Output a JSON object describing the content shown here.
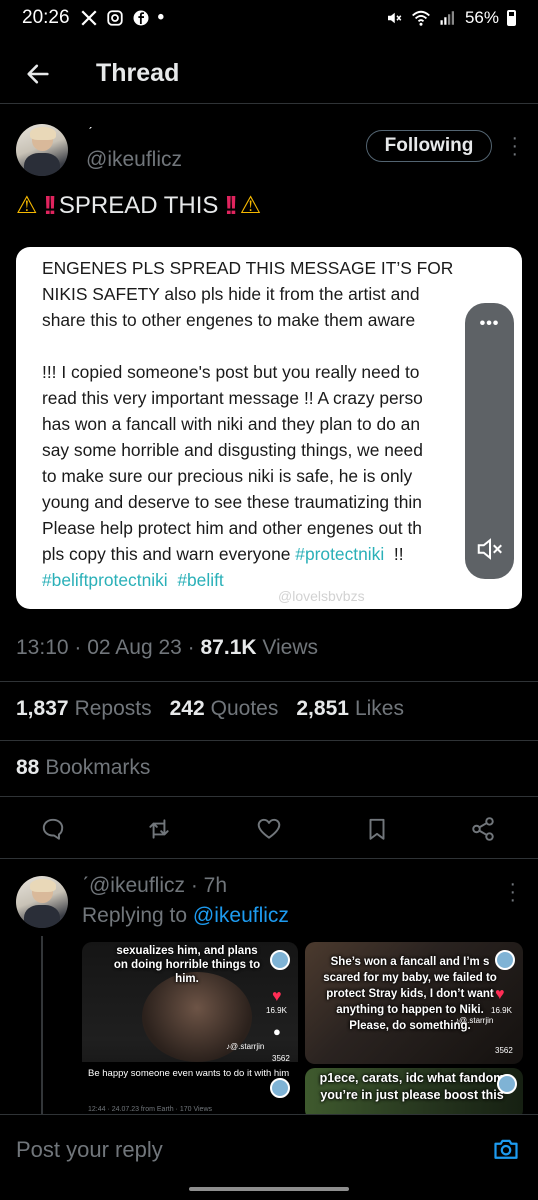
{
  "status_bar": {
    "time": "20:26",
    "left_icons": [
      "x-icon",
      "instagram-icon",
      "facebook-icon"
    ],
    "dot": "•",
    "battery": "56%"
  },
  "header": {
    "title": "Thread"
  },
  "post": {
    "tick": "ˊ",
    "handle": "@ikeuflicz",
    "follow_label": "Following",
    "text": "SPREAD THIS",
    "media": {
      "lines": [
        "ENGENES PLS SPREAD THIS MESSAGE IT’S FOR",
        "NIKIS SAFETY also pls hide it from the artist and",
        "share this to other engenes to make them aware",
        "",
        "!!! I copied someone's post but you really need to",
        "read this very important message !! A crazy perso",
        "has won a fancall with niki and they plan to do an",
        "say some horrible and disgusting things, we need",
        "to make sure our precious niki is safe, he is only",
        "young and deserve to see these traumatizing thin",
        "Please help protect him and other engenes out th",
        "pls copy this and warn everyone"
      ],
      "hashtag_inline": "#protectniki",
      "trail": "!!",
      "hashtags_last": [
        "#beliftprotectniki",
        "#belift"
      ],
      "watermark": "@lovelsbvbzs",
      "overlay_dots": "•••"
    },
    "time": "13:10",
    "date": "02 Aug 23",
    "views_num": "87.1K",
    "views_label": "Views",
    "stats": {
      "reposts": "1,837",
      "reposts_label": "Reposts",
      "quotes": "242",
      "quotes_label": "Quotes",
      "likes": "2,851",
      "likes_label": "Likes"
    },
    "bookmarks": "88",
    "bookmarks_label": "Bookmarks"
  },
  "reply": {
    "handle": "ˊ@ikeuflicz · 7h",
    "replying_to": "Replying to",
    "replying_handle": "@ikeuflicz",
    "thumb1": {
      "caption": "sexualizes him, and plans on doing horrible things to him.",
      "likes": "16.9K",
      "user": "♪@.starrjin",
      "count": "3562",
      "bottom_caption": "Be happy someone even wants to do it with him",
      "footer": "12:44 · 24.07.23 from Earth · 170 Views"
    },
    "thumb2": {
      "caption": "She’s won a fancall and I’m s scared for my baby, we failed to protect Stray kids, I don’t want anything to happen to Niki. Please, do something.",
      "likes": "16.9K",
      "user": "♪@.starrjin",
      "count": "3562"
    },
    "thumb3": {
      "caption": "p1ece, carats, idc what fandom you’re in just please boost this"
    }
  },
  "compose": {
    "placeholder": "Post your reply"
  }
}
